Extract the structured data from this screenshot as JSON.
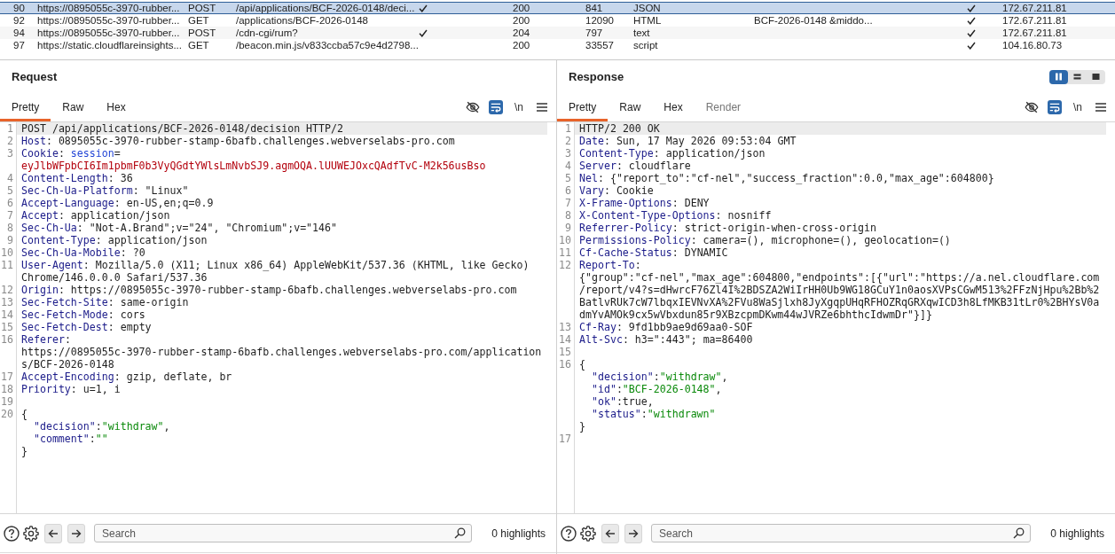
{
  "table": {
    "rows": [
      {
        "column_1": "90",
        "column_2": "https://0895055c-3970-rubber...",
        "column_3": "POST",
        "column_4": "/api/applications/BCF-2026-0148/deci...",
        "column_5": true,
        "column_6": "200",
        "column_7": "841",
        "column_8": "JSON",
        "column_10": true,
        "column_11": "172.67.211.81",
        "selected": true
      },
      {
        "column_1": "92",
        "column_2": "https://0895055c-3970-rubber...",
        "column_3": "GET",
        "column_4": "/applications/BCF-2026-0148",
        "column_5": false,
        "column_6": "200",
        "column_7": "12090",
        "column_8": "HTML",
        "column_9": "BCF-2026-0148 &middo...",
        "column_10": true,
        "column_11": "172.67.211.81",
        "selected": false
      },
      {
        "column_1": "94",
        "column_2": "https://0895055c-3970-rubber...",
        "column_3": "POST",
        "column_4": "/cdn-cgi/rum?",
        "column_5": true,
        "column_6": "204",
        "column_7": "797",
        "column_8": "text",
        "column_10": true,
        "column_11": "172.67.211.81",
        "selected": false
      },
      {
        "column_1": "97",
        "column_2": "https://static.cloudflareinsights...",
        "column_3": "GET",
        "column_4": "/beacon.min.js/v833ccba57c9e4d2798...",
        "column_5": false,
        "column_6": "200",
        "column_7": "33557",
        "column_8": "script",
        "column_10": true,
        "column_11": "104.16.80.73",
        "selected": false
      }
    ]
  },
  "request": {
    "title": "Request",
    "tabs": [
      {
        "label": "Pretty",
        "selected": true,
        "disabled": false
      },
      {
        "label": "Raw",
        "selected": false,
        "disabled": false
      },
      {
        "label": "Hex",
        "selected": false,
        "disabled": false
      }
    ],
    "tools": [
      {
        "kind": "hide",
        "on": false
      },
      {
        "kind": "wrap",
        "on": true
      },
      {
        "kind": "newline",
        "label": "\\n",
        "on": false
      },
      {
        "kind": "menu"
      }
    ],
    "lines": [
      {
        "number": "1",
        "parts": [
          {
            "kind": "text",
            "text": "POST /api/applications/BCF-2026-0148/decision HTTP/2"
          }
        ],
        "current": true
      },
      {
        "number": "2",
        "parts": [
          {
            "kind": "name",
            "text": "Host"
          },
          {
            "kind": "text",
            "text": ": 0895055c-3970-rubber-stamp-6bafb.challenges.webverselabs-pro.com"
          }
        ],
        "current": false
      },
      {
        "number": "3",
        "parts": [
          {
            "kind": "name",
            "text": "Cookie"
          },
          {
            "kind": "text",
            "text": ": "
          },
          {
            "kind": "param",
            "text": "session"
          },
          {
            "kind": "text",
            "text": "="
          },
          {
            "kind": "token",
            "text": "eyJlbWFpbCI6Im1pbmF0b3VyQGdtYWlsLmNvbSJ9.agmOQA.lUUWEJOxcQAdfTvC-M2k56usBso"
          }
        ],
        "current": false
      },
      {
        "number": "4",
        "parts": [
          {
            "kind": "name",
            "text": "Content-Length"
          },
          {
            "kind": "text",
            "text": ": 36"
          }
        ],
        "current": false
      },
      {
        "number": "5",
        "parts": [
          {
            "kind": "name",
            "text": "Sec-Ch-Ua-Platform"
          },
          {
            "kind": "text",
            "text": ": \"Linux\""
          }
        ],
        "current": false
      },
      {
        "number": "6",
        "parts": [
          {
            "kind": "name",
            "text": "Accept-Language"
          },
          {
            "kind": "text",
            "text": ": en-US,en;q=0.9"
          }
        ],
        "current": false
      },
      {
        "number": "7",
        "parts": [
          {
            "kind": "name",
            "text": "Accept"
          },
          {
            "kind": "text",
            "text": ": application/json"
          }
        ],
        "current": false
      },
      {
        "number": "8",
        "parts": [
          {
            "kind": "name",
            "text": "Sec-Ch-Ua"
          },
          {
            "kind": "text",
            "text": ": \"Not-A.Brand\";v=\"24\", \"Chromium\";v=\"146\""
          }
        ],
        "current": false
      },
      {
        "number": "9",
        "parts": [
          {
            "kind": "name",
            "text": "Content-Type"
          },
          {
            "kind": "text",
            "text": ": application/json"
          }
        ],
        "current": false
      },
      {
        "number": "10",
        "parts": [
          {
            "kind": "name",
            "text": "Sec-Ch-Ua-Mobile"
          },
          {
            "kind": "text",
            "text": ": ?0"
          }
        ],
        "current": false
      },
      {
        "number": "11",
        "parts": [
          {
            "kind": "name",
            "text": "User-Agent"
          },
          {
            "kind": "text",
            "text": ": Mozilla/5.0 (X11; Linux x86_64) AppleWebKit/537.36 (KHTML, like Gecko) Chrome/146.0.0.0 Safari/537.36"
          }
        ],
        "current": false
      },
      {
        "number": "12",
        "parts": [
          {
            "kind": "name",
            "text": "Origin"
          },
          {
            "kind": "text",
            "text": ": https://0895055c-3970-rubber-stamp-6bafb.challenges.webverselabs-pro.com"
          }
        ],
        "current": false
      },
      {
        "number": "13",
        "parts": [
          {
            "kind": "name",
            "text": "Sec-Fetch-Site"
          },
          {
            "kind": "text",
            "text": ": same-origin"
          }
        ],
        "current": false
      },
      {
        "number": "14",
        "parts": [
          {
            "kind": "name",
            "text": "Sec-Fetch-Mode"
          },
          {
            "kind": "text",
            "text": ": cors"
          }
        ],
        "current": false
      },
      {
        "number": "15",
        "parts": [
          {
            "kind": "name",
            "text": "Sec-Fetch-Dest"
          },
          {
            "kind": "text",
            "text": ": empty"
          }
        ],
        "current": false
      },
      {
        "number": "16",
        "parts": [
          {
            "kind": "name",
            "text": "Referer"
          },
          {
            "kind": "text",
            "text": ": https://0895055c-3970-rubber-stamp-6bafb.challenges.webverselabs-pro.com/applications/BCF-2026-0148"
          }
        ],
        "current": false
      },
      {
        "number": "17",
        "parts": [
          {
            "kind": "name",
            "text": "Accept-Encoding"
          },
          {
            "kind": "text",
            "text": ": gzip, deflate, br"
          }
        ],
        "current": false
      },
      {
        "number": "18",
        "parts": [
          {
            "kind": "name",
            "text": "Priority"
          },
          {
            "kind": "text",
            "text": ": u=1, i"
          }
        ],
        "current": false
      },
      {
        "number": "19",
        "current": false
      },
      {
        "number": "20",
        "parts": [
          {
            "kind": "text",
            "text": "{"
          }
        ],
        "children": [
          {
            "parts": [
              {
                "kind": "key",
                "text": "\"decision\""
              },
              {
                "kind": "text",
                "text": ":"
              },
              {
                "kind": "string",
                "text": "\"withdraw\""
              },
              {
                "kind": "text",
                "text": ","
              }
            ]
          },
          {
            "parts": [
              {
                "kind": "key",
                "text": "\"comment\""
              },
              {
                "kind": "text",
                "text": ":"
              },
              {
                "kind": "string",
                "text": "\"\""
              }
            ]
          }
        ],
        "close": [
          {
            "kind": "text",
            "text": "}"
          }
        ],
        "current": false
      }
    ],
    "search": {
      "placeholder": "Search"
    },
    "highlights": "0 highlights"
  },
  "response": {
    "title": "Response",
    "layout_toggle": [
      {
        "kind": "columns",
        "selected": true
      },
      {
        "kind": "rows",
        "selected": false
      },
      {
        "kind": "single",
        "selected": false
      }
    ],
    "tabs": [
      {
        "label": "Pretty",
        "selected": true,
        "disabled": false
      },
      {
        "label": "Raw",
        "selected": false,
        "disabled": false
      },
      {
        "label": "Hex",
        "selected": false,
        "disabled": false
      },
      {
        "label": "Render",
        "selected": false,
        "disabled": true
      }
    ],
    "tools": [
      {
        "kind": "hide",
        "on": false
      },
      {
        "kind": "wrap",
        "on": true
      },
      {
        "kind": "newline",
        "label": "\\n",
        "on": false
      },
      {
        "kind": "menu"
      }
    ],
    "lines": [
      {
        "number": "1",
        "parts": [
          {
            "kind": "text",
            "text": "HTTP/2 200 OK"
          }
        ],
        "current": true
      },
      {
        "number": "2",
        "parts": [
          {
            "kind": "name",
            "text": "Date"
          },
          {
            "kind": "text",
            "text": ": Sun, 17 May 2026 09:53:04 GMT"
          }
        ],
        "current": false
      },
      {
        "number": "3",
        "parts": [
          {
            "kind": "name",
            "text": "Content-Type"
          },
          {
            "kind": "text",
            "text": ": application/json"
          }
        ],
        "current": false
      },
      {
        "number": "4",
        "parts": [
          {
            "kind": "name",
            "text": "Server"
          },
          {
            "kind": "text",
            "text": ": cloudflare"
          }
        ],
        "current": false
      },
      {
        "number": "5",
        "parts": [
          {
            "kind": "name",
            "text": "Nel"
          },
          {
            "kind": "text",
            "text": ": {\"report_to\":\"cf-nel\",\"success_fraction\":0.0,\"max_age\":604800}"
          }
        ],
        "current": false
      },
      {
        "number": "6",
        "parts": [
          {
            "kind": "name",
            "text": "Vary"
          },
          {
            "kind": "text",
            "text": ": Cookie"
          }
        ],
        "current": false
      },
      {
        "number": "7",
        "parts": [
          {
            "kind": "name",
            "text": "X-Frame-Options"
          },
          {
            "kind": "text",
            "text": ": DENY"
          }
        ],
        "current": false
      },
      {
        "number": "8",
        "parts": [
          {
            "kind": "name",
            "text": "X-Content-Type-Options"
          },
          {
            "kind": "text",
            "text": ": nosniff"
          }
        ],
        "current": false
      },
      {
        "number": "9",
        "parts": [
          {
            "kind": "name",
            "text": "Referrer-Policy"
          },
          {
            "kind": "text",
            "text": ": strict-origin-when-cross-origin"
          }
        ],
        "current": false
      },
      {
        "number": "10",
        "parts": [
          {
            "kind": "name",
            "text": "Permissions-Policy"
          },
          {
            "kind": "text",
            "text": ": camera=(), microphone=(), geolocation=()"
          }
        ],
        "current": false
      },
      {
        "number": "11",
        "parts": [
          {
            "kind": "name",
            "text": "Cf-Cache-Status"
          },
          {
            "kind": "text",
            "text": ": DYNAMIC"
          }
        ],
        "current": false
      },
      {
        "number": "12",
        "parts": [
          {
            "kind": "name",
            "text": "Report-To"
          },
          {
            "kind": "text",
            "text": ": {\"group\":\"cf-nel\",\"max_age\":604800,\"endpoints\":[{\"url\":\"https://a.nel.cloudflare.com/report/v4?s=dHwrcF76Zl4I%2BDSZA2WiIrHH0Ub9WG18GCuY1n0aosXVPsCGwM513%2FFzNjHpu%2Bb%2BatlvRUk7cW7lbqxIEVNvXA%2FVu8WaSjlxh8JyXgqpUHqRFHOZRqGRXqwICD3h8LfMKB31tLr0%2BHYsV0admYvAMOk9cx5wVbxdun85r9XBzcpmDKwm44wJVRZe6bhthcIdwmDr\"}]}"
          }
        ],
        "current": false
      },
      {
        "number": "13",
        "parts": [
          {
            "kind": "name",
            "text": "Cf-Ray"
          },
          {
            "kind": "text",
            "text": ": 9fd1bb9ae9d69aa0-SOF"
          }
        ],
        "current": false
      },
      {
        "number": "14",
        "parts": [
          {
            "kind": "name",
            "text": "Alt-Svc"
          },
          {
            "kind": "text",
            "text": ": h3=\":443\"; ma=86400"
          }
        ],
        "current": false
      },
      {
        "number": "15",
        "current": false
      },
      {
        "number": "16",
        "parts": [
          {
            "kind": "text",
            "text": "{"
          }
        ],
        "children": [
          {
            "parts": [
              {
                "kind": "key",
                "text": "\"decision\""
              },
              {
                "kind": "text",
                "text": ":"
              },
              {
                "kind": "string",
                "text": "\"withdraw\""
              },
              {
                "kind": "text",
                "text": ","
              }
            ]
          },
          {
            "parts": [
              {
                "kind": "key",
                "text": "\"id\""
              },
              {
                "kind": "text",
                "text": ":"
              },
              {
                "kind": "string",
                "text": "\"BCF-2026-0148\""
              },
              {
                "kind": "text",
                "text": ","
              }
            ]
          },
          {
            "parts": [
              {
                "kind": "key",
                "text": "\"ok\""
              },
              {
                "kind": "text",
                "text": ":true,"
              }
            ]
          },
          {
            "parts": [
              {
                "kind": "key",
                "text": "\"status\""
              },
              {
                "kind": "text",
                "text": ":"
              },
              {
                "kind": "string",
                "text": "\"withdrawn\""
              }
            ]
          }
        ],
        "close": [
          {
            "kind": "text",
            "text": "}"
          }
        ],
        "current": false
      },
      {
        "number": "17",
        "current": false
      }
    ],
    "search": {
      "placeholder": "Search"
    },
    "highlights": "0 highlights"
  }
}
